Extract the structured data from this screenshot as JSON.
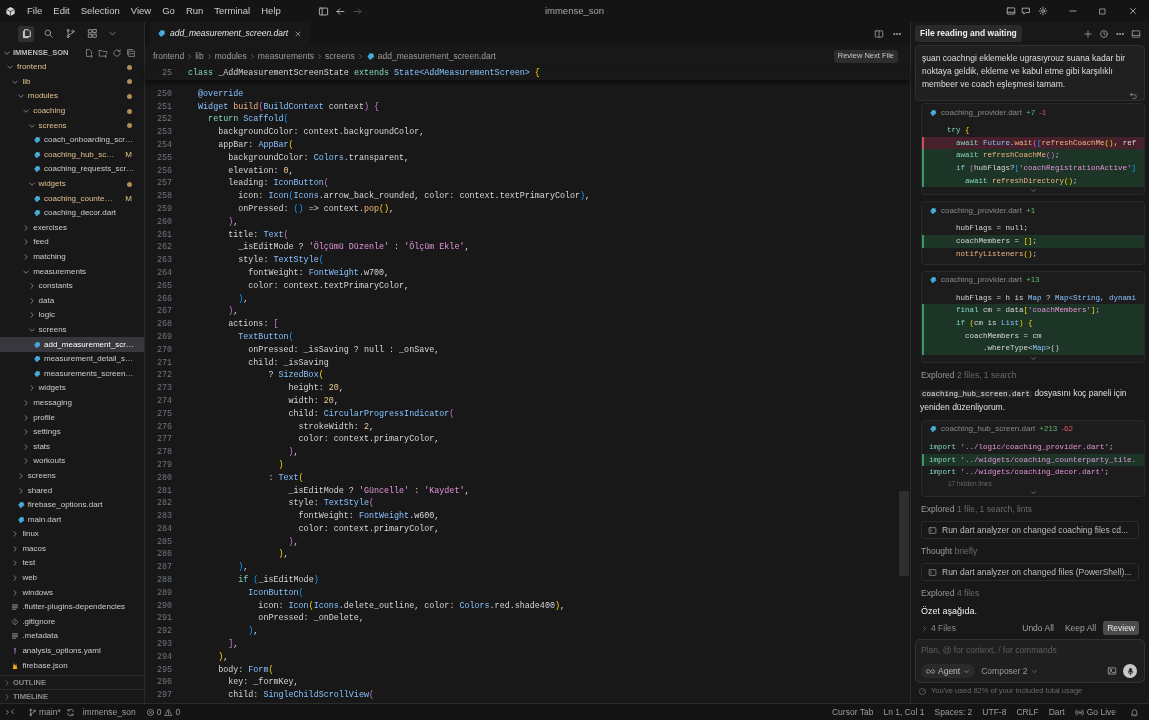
{
  "menu": [
    "File",
    "Edit",
    "Selection",
    "View",
    "Go",
    "Run",
    "Terminal",
    "Help"
  ],
  "window_title": "immense_son",
  "sidebar_tools": [
    {
      "selected": true
    },
    {
      "selected": false
    },
    {
      "selected": false
    },
    {
      "selected": false
    }
  ],
  "explorer": {
    "title": "IMMENSE_SON",
    "expanded": true,
    "tree": [
      {
        "label": "frontend",
        "kind": "folder",
        "expanded": true,
        "modified": true,
        "selected": false,
        "children": [
          {
            "label": "lib",
            "kind": "folder",
            "expanded": true,
            "modified": true,
            "selected": false,
            "children": [
              {
                "label": "modules",
                "kind": "folder",
                "expanded": true,
                "modified": true,
                "selected": false,
                "children": [
                  {
                    "label": "coaching",
                    "kind": "folder",
                    "expanded": true,
                    "modified": true,
                    "selected": false,
                    "children": [
                      {
                        "label": "screens",
                        "kind": "folder",
                        "expanded": true,
                        "modified": true,
                        "selected": false,
                        "children": [
                          {
                            "label": "coach_onboarding_scr…",
                            "kind": "dart",
                            "modified": false,
                            "selected": false
                          },
                          {
                            "label": "coaching_hub_sc…",
                            "kind": "dart",
                            "modified": true,
                            "badge": "M",
                            "selected": false
                          },
                          {
                            "label": "coaching_requests_scr…",
                            "kind": "dart",
                            "modified": false,
                            "selected": false
                          }
                        ]
                      },
                      {
                        "label": "widgets",
                        "kind": "folder",
                        "expanded": true,
                        "modified": true,
                        "selected": false,
                        "children": [
                          {
                            "label": "coaching_counte…",
                            "kind": "dart",
                            "modified": true,
                            "badge": "M",
                            "selected": false
                          },
                          {
                            "label": "coaching_decor.dart",
                            "kind": "dart",
                            "modified": false,
                            "selected": false
                          }
                        ]
                      }
                    ]
                  },
                  {
                    "label": "exercises",
                    "kind": "folder",
                    "expanded": false,
                    "modified": false,
                    "selected": false
                  },
                  {
                    "label": "feed",
                    "kind": "folder",
                    "expanded": false,
                    "modified": false,
                    "selected": false
                  },
                  {
                    "label": "matching",
                    "kind": "folder",
                    "expanded": false,
                    "modified": false,
                    "selected": false
                  },
                  {
                    "label": "measurements",
                    "kind": "folder",
                    "expanded": true,
                    "modified": false,
                    "selected": false,
                    "children": [
                      {
                        "label": "constants",
                        "kind": "folder",
                        "expanded": false,
                        "modified": false,
                        "selected": false
                      },
                      {
                        "label": "data",
                        "kind": "folder",
                        "expanded": false,
                        "modified": false,
                        "selected": false
                      },
                      {
                        "label": "logic",
                        "kind": "folder",
                        "expanded": false,
                        "modified": false,
                        "selected": false
                      },
                      {
                        "label": "screens",
                        "kind": "folder",
                        "expanded": true,
                        "modified": false,
                        "selected": false,
                        "children": [
                          {
                            "label": "add_measurement_scr…",
                            "kind": "dart",
                            "modified": false,
                            "selected": true
                          },
                          {
                            "label": "measurement_detail_s…",
                            "kind": "dart",
                            "modified": false,
                            "selected": false
                          },
                          {
                            "label": "measurements_screen…",
                            "kind": "dart",
                            "modified": false,
                            "selected": false
                          }
                        ]
                      },
                      {
                        "label": "widgets",
                        "kind": "folder",
                        "expanded": false,
                        "modified": false,
                        "selected": false
                      }
                    ]
                  },
                  {
                    "label": "messaging",
                    "kind": "folder",
                    "expanded": false,
                    "modified": false,
                    "selected": false
                  },
                  {
                    "label": "profile",
                    "kind": "folder",
                    "expanded": false,
                    "modified": false,
                    "selected": false
                  },
                  {
                    "label": "settings",
                    "kind": "folder",
                    "expanded": false,
                    "modified": false,
                    "selected": false
                  },
                  {
                    "label": "stats",
                    "kind": "folder",
                    "expanded": false,
                    "modified": false,
                    "selected": false
                  },
                  {
                    "label": "workouts",
                    "kind": "folder",
                    "expanded": false,
                    "modified": false,
                    "selected": false
                  }
                ]
              },
              {
                "label": "screens",
                "kind": "folder",
                "expanded": false,
                "modified": false,
                "selected": false
              },
              {
                "label": "shared",
                "kind": "folder",
                "expanded": false,
                "modified": false,
                "selected": false
              },
              {
                "label": "firebase_options.dart",
                "kind": "dart",
                "modified": false,
                "selected": false
              },
              {
                "label": "main.dart",
                "kind": "dart",
                "modified": false,
                "selected": false
              }
            ]
          },
          {
            "label": "linux",
            "kind": "folder",
            "expanded": false,
            "modified": false,
            "selected": false
          },
          {
            "label": "macos",
            "kind": "folder",
            "expanded": false,
            "modified": false,
            "selected": false
          },
          {
            "label": "test",
            "kind": "folder",
            "expanded": false,
            "modified": false,
            "selected": false
          },
          {
            "label": "web",
            "kind": "folder",
            "expanded": false,
            "modified": false,
            "selected": false
          },
          {
            "label": "windows",
            "kind": "folder",
            "expanded": false,
            "modified": false,
            "selected": false
          },
          {
            "label": ".flutter-plugins-dependencies",
            "kind": "lines",
            "modified": false,
            "selected": false
          },
          {
            "label": ".gitignore",
            "kind": "git",
            "modified": false,
            "selected": false
          },
          {
            "label": ".metadata",
            "kind": "lines",
            "modified": false,
            "selected": false
          },
          {
            "label": "analysis_options.yaml",
            "kind": "yaml",
            "modified": false,
            "selected": false
          },
          {
            "label": "firebase.json",
            "kind": "json",
            "modified": false,
            "selected": false
          }
        ]
      }
    ]
  },
  "panels": [
    {
      "label": "OUTLINE",
      "expanded": false
    },
    {
      "label": "TIMELINE",
      "expanded": false
    }
  ],
  "editor": {
    "tab": {
      "label": "add_measurement_screen.dart",
      "selected": true
    },
    "breadcrumbs": [
      "frontend",
      "lib",
      "modules",
      "measurements",
      "screens",
      "add_measurement_screen.dart"
    ],
    "review_button": "Review Next File",
    "sticky_line": {
      "n": "25",
      "tokens": [
        {
          "text": "class",
          "kind": "k"
        },
        {
          "text": " _AddMeasurementScreenState ",
          "kind": "p"
        },
        {
          "text": "extends",
          "kind": "k"
        },
        {
          "text": " State<AddMeasurementScreen> ",
          "kind": "t"
        },
        {
          "text": "{",
          "kind": "b1"
        }
      ]
    },
    "lines": [
      {
        "n": "250",
        "tokens": [
          {
            "text": "  @override",
            "kind": "t"
          }
        ]
      },
      {
        "n": "251",
        "tokens": [
          {
            "text": "  Widget",
            "kind": "t"
          },
          {
            "text": " build",
            "kind": "f"
          },
          {
            "text": "(",
            "kind": "b2"
          },
          {
            "text": "BuildContext",
            "kind": "t"
          },
          {
            "text": " context",
            "kind": "p"
          },
          {
            "text": ")",
            "kind": "b2"
          },
          {
            "text": " {",
            "kind": "b2"
          }
        ]
      },
      {
        "n": "252",
        "tokens": [
          {
            "text": "    return",
            "kind": "k"
          },
          {
            "text": " Scaffold",
            "kind": "t"
          },
          {
            "text": "(",
            "kind": "b3"
          }
        ]
      },
      {
        "n": "253",
        "tokens": [
          {
            "text": "      backgroundColor: context.backgroundColor,",
            "kind": "p"
          }
        ]
      },
      {
        "n": "254",
        "tokens": [
          {
            "text": "      appBar: ",
            "kind": "p"
          },
          {
            "text": "AppBar",
            "kind": "t"
          },
          {
            "text": "(",
            "kind": "b1"
          }
        ]
      },
      {
        "n": "255",
        "tokens": [
          {
            "text": "        backgroundColor: ",
            "kind": "p"
          },
          {
            "text": "Colors",
            "kind": "t"
          },
          {
            "text": ".transparent,",
            "kind": "p"
          }
        ]
      },
      {
        "n": "256",
        "tokens": [
          {
            "text": "        elevation: ",
            "kind": "p"
          },
          {
            "text": "0",
            "kind": "n"
          },
          {
            "text": ",",
            "kind": "p"
          }
        ]
      },
      {
        "n": "257",
        "tokens": [
          {
            "text": "        leading: ",
            "kind": "p"
          },
          {
            "text": "IconButton",
            "kind": "t"
          },
          {
            "text": "(",
            "kind": "b2"
          }
        ]
      },
      {
        "n": "258",
        "tokens": [
          {
            "text": "          icon: ",
            "kind": "p"
          },
          {
            "text": "Icon",
            "kind": "t"
          },
          {
            "text": "(",
            "kind": "b3"
          },
          {
            "text": "Icons",
            "kind": "t"
          },
          {
            "text": ".arrow_back_rounded, color: context.textPrimaryColor",
            "kind": "p"
          },
          {
            "text": ")",
            "kind": "b3"
          },
          {
            "text": ",",
            "kind": "p"
          }
        ]
      },
      {
        "n": "259",
        "tokens": [
          {
            "text": "          onPressed: ",
            "kind": "p"
          },
          {
            "text": "()",
            "kind": "b3"
          },
          {
            "text": " => context.",
            "kind": "p"
          },
          {
            "text": "pop",
            "kind": "f"
          },
          {
            "text": "()",
            "kind": "b1"
          },
          {
            "text": ",",
            "kind": "p"
          }
        ]
      },
      {
        "n": "260",
        "tokens": [
          {
            "text": "        )",
            "kind": "b2"
          },
          {
            "text": ",",
            "kind": "p"
          }
        ]
      },
      {
        "n": "261",
        "tokens": [
          {
            "text": "        title: ",
            "kind": "p"
          },
          {
            "text": "Text",
            "kind": "t"
          },
          {
            "text": "(",
            "kind": "b2"
          }
        ]
      },
      {
        "n": "262",
        "tokens": [
          {
            "text": "          _isEditMode ? ",
            "kind": "p"
          },
          {
            "text": "'Ölçümü Düzenle'",
            "kind": "s"
          },
          {
            "text": " : ",
            "kind": "p"
          },
          {
            "text": "'Ölçüm Ekle'",
            "kind": "s"
          },
          {
            "text": ",",
            "kind": "p"
          }
        ]
      },
      {
        "n": "263",
        "tokens": [
          {
            "text": "          style: ",
            "kind": "p"
          },
          {
            "text": "TextStyle",
            "kind": "t"
          },
          {
            "text": "(",
            "kind": "b3"
          }
        ]
      },
      {
        "n": "264",
        "tokens": [
          {
            "text": "            fontWeight: ",
            "kind": "p"
          },
          {
            "text": "FontWeight",
            "kind": "t"
          },
          {
            "text": ".w700,",
            "kind": "p"
          }
        ]
      },
      {
        "n": "265",
        "tokens": [
          {
            "text": "            color: context.textPrimaryColor,",
            "kind": "p"
          }
        ]
      },
      {
        "n": "266",
        "tokens": [
          {
            "text": "          )",
            "kind": "b3"
          },
          {
            "text": ",",
            "kind": "p"
          }
        ]
      },
      {
        "n": "267",
        "tokens": [
          {
            "text": "        )",
            "kind": "b2"
          },
          {
            "text": ",",
            "kind": "p"
          }
        ]
      },
      {
        "n": "268",
        "tokens": [
          {
            "text": "        actions: ",
            "kind": "p"
          },
          {
            "text": "[",
            "kind": "b2"
          }
        ]
      },
      {
        "n": "269",
        "tokens": [
          {
            "text": "          TextButton",
            "kind": "t"
          },
          {
            "text": "(",
            "kind": "b3"
          }
        ]
      },
      {
        "n": "270",
        "tokens": [
          {
            "text": "            onPressed: _isSaving ? null : _onSave,",
            "kind": "p"
          }
        ]
      },
      {
        "n": "271",
        "tokens": [
          {
            "text": "            child: _isSaving",
            "kind": "p"
          }
        ]
      },
      {
        "n": "272",
        "tokens": [
          {
            "text": "                ? ",
            "kind": "p"
          },
          {
            "text": "SizedBox",
            "kind": "t"
          },
          {
            "text": "(",
            "kind": "b1"
          }
        ]
      },
      {
        "n": "273",
        "tokens": [
          {
            "text": "                    height: ",
            "kind": "p"
          },
          {
            "text": "20",
            "kind": "n"
          },
          {
            "text": ",",
            "kind": "p"
          }
        ]
      },
      {
        "n": "274",
        "tokens": [
          {
            "text": "                    width: ",
            "kind": "p"
          },
          {
            "text": "20",
            "kind": "n"
          },
          {
            "text": ",",
            "kind": "p"
          }
        ]
      },
      {
        "n": "275",
        "tokens": [
          {
            "text": "                    child: ",
            "kind": "p"
          },
          {
            "text": "CircularProgressIndicator",
            "kind": "t"
          },
          {
            "text": "(",
            "kind": "b2"
          }
        ]
      },
      {
        "n": "276",
        "tokens": [
          {
            "text": "                      strokeWidth: ",
            "kind": "p"
          },
          {
            "text": "2",
            "kind": "n"
          },
          {
            "text": ",",
            "kind": "p"
          }
        ]
      },
      {
        "n": "277",
        "tokens": [
          {
            "text": "                      color: context.primaryColor,",
            "kind": "p"
          }
        ]
      },
      {
        "n": "278",
        "tokens": [
          {
            "text": "                    )",
            "kind": "b2"
          },
          {
            "text": ",",
            "kind": "p"
          }
        ]
      },
      {
        "n": "279",
        "tokens": [
          {
            "text": "                  )",
            "kind": "b1"
          }
        ]
      },
      {
        "n": "280",
        "tokens": [
          {
            "text": "                : ",
            "kind": "p"
          },
          {
            "text": "Text",
            "kind": "t"
          },
          {
            "text": "(",
            "kind": "b1"
          }
        ]
      },
      {
        "n": "281",
        "tokens": [
          {
            "text": "                    _isEditMode ? ",
            "kind": "p"
          },
          {
            "text": "'Güncelle'",
            "kind": "s"
          },
          {
            "text": " : ",
            "kind": "p"
          },
          {
            "text": "'Kaydet'",
            "kind": "s"
          },
          {
            "text": ",",
            "kind": "p"
          }
        ]
      },
      {
        "n": "282",
        "tokens": [
          {
            "text": "                    style: ",
            "kind": "p"
          },
          {
            "text": "TextStyle",
            "kind": "t"
          },
          {
            "text": "(",
            "kind": "b2"
          }
        ]
      },
      {
        "n": "283",
        "tokens": [
          {
            "text": "                      fontWeight: ",
            "kind": "p"
          },
          {
            "text": "FontWeight",
            "kind": "t"
          },
          {
            "text": ".w600,",
            "kind": "p"
          }
        ]
      },
      {
        "n": "284",
        "tokens": [
          {
            "text": "                      color: context.primaryColor,",
            "kind": "p"
          }
        ]
      },
      {
        "n": "285",
        "tokens": [
          {
            "text": "                    )",
            "kind": "b2"
          },
          {
            "text": ",",
            "kind": "p"
          }
        ]
      },
      {
        "n": "286",
        "tokens": [
          {
            "text": "                  )",
            "kind": "b1"
          },
          {
            "text": ",",
            "kind": "p"
          }
        ]
      },
      {
        "n": "287",
        "tokens": [
          {
            "text": "          )",
            "kind": "b3"
          },
          {
            "text": ",",
            "kind": "p"
          }
        ]
      },
      {
        "n": "288",
        "tokens": [
          {
            "text": "          if ",
            "kind": "k"
          },
          {
            "text": "(",
            "kind": "b3"
          },
          {
            "text": "_isEditMode",
            "kind": "p"
          },
          {
            "text": ")",
            "kind": "b3"
          }
        ]
      },
      {
        "n": "289",
        "tokens": [
          {
            "text": "            IconButton",
            "kind": "t"
          },
          {
            "text": "(",
            "kind": "b3"
          }
        ]
      },
      {
        "n": "290",
        "tokens": [
          {
            "text": "              icon: ",
            "kind": "p"
          },
          {
            "text": "Icon",
            "kind": "t"
          },
          {
            "text": "(",
            "kind": "b1"
          },
          {
            "text": "Icons",
            "kind": "t"
          },
          {
            "text": ".delete_outline, color: ",
            "kind": "p"
          },
          {
            "text": "Colors",
            "kind": "t"
          },
          {
            "text": ".red.shade400",
            "kind": "p"
          },
          {
            "text": ")",
            "kind": "b1"
          },
          {
            "text": ",",
            "kind": "p"
          }
        ]
      },
      {
        "n": "291",
        "tokens": [
          {
            "text": "              onPressed: _onDelete,",
            "kind": "p"
          }
        ]
      },
      {
        "n": "292",
        "tokens": [
          {
            "text": "            )",
            "kind": "b3"
          },
          {
            "text": ",",
            "kind": "p"
          }
        ]
      },
      {
        "n": "293",
        "tokens": [
          {
            "text": "        ]",
            "kind": "b2"
          },
          {
            "text": ",",
            "kind": "p"
          }
        ]
      },
      {
        "n": "294",
        "tokens": [
          {
            "text": "      )",
            "kind": "b1"
          },
          {
            "text": ",",
            "kind": "p"
          }
        ]
      },
      {
        "n": "295",
        "tokens": [
          {
            "text": "      body: ",
            "kind": "p"
          },
          {
            "text": "Form",
            "kind": "t"
          },
          {
            "text": "(",
            "kind": "b1"
          }
        ]
      },
      {
        "n": "296",
        "tokens": [
          {
            "text": "        key: _formKey,",
            "kind": "p"
          }
        ]
      },
      {
        "n": "297",
        "tokens": [
          {
            "text": "        child: ",
            "kind": "p"
          },
          {
            "text": "SingleChildScrollView",
            "kind": "t"
          },
          {
            "text": "(",
            "kind": "b2"
          }
        ]
      }
    ]
  },
  "chat": {
    "title": "File reading and waiting",
    "message": "şuan coachngi eklemekle ugrasıyrouz suana kadar bir noktaya geldik, ekleme ve kabul etme gibi karşılıklı membeer ve coach eşleşmesi tamam.",
    "feed": [
      {
        "kind": "diff",
        "file": "coaching_provider.dart",
        "added": "+7",
        "removed": "-1",
        "collapsed": true,
        "lines": [
          {
            "kind": "context",
            "tokens": [
              {
                "text": "    try ",
                "kind": "k"
              },
              {
                "text": "{",
                "kind": "b1"
              }
            ]
          },
          {
            "kind": "removed",
            "tokens": [
              {
                "text": "      await",
                "kind": "k"
              },
              {
                "text": " Future",
                "kind": "t"
              },
              {
                "text": ".",
                "kind": "p"
              },
              {
                "text": "wait",
                "kind": "f"
              },
              {
                "text": "(",
                "kind": "b2"
              },
              {
                "text": "[",
                "kind": "b3"
              },
              {
                "text": "refreshCoachMe",
                "kind": "f"
              },
              {
                "text": "()",
                "kind": "b1"
              },
              {
                "text": ", ref",
                "kind": "p"
              }
            ]
          },
          {
            "kind": "added",
            "tokens": [
              {
                "text": "      await",
                "kind": "k"
              },
              {
                "text": " refreshCoachMe",
                "kind": "f"
              },
              {
                "text": "()",
                "kind": "b2"
              },
              {
                "text": ";",
                "kind": "p"
              }
            ]
          },
          {
            "kind": "added",
            "tokens": [
              {
                "text": "      if ",
                "kind": "k"
              },
              {
                "text": "(",
                "kind": "b2"
              },
              {
                "text": "hubFlags?",
                "kind": "p"
              },
              {
                "text": "[",
                "kind": "b3"
              },
              {
                "text": "'coachRegistrationActive'",
                "kind": "s"
              },
              {
                "text": "]",
                "kind": "b3"
              }
            ]
          },
          {
            "kind": "added",
            "tokens": [
              {
                "text": "        await",
                "kind": "k"
              },
              {
                "text": " refreshDirectory",
                "kind": "f"
              },
              {
                "text": "()",
                "kind": "b1"
              },
              {
                "text": ";",
                "kind": "p"
              }
            ]
          }
        ]
      },
      {
        "kind": "diff",
        "file": "coaching_provider.dart",
        "added": "+1",
        "collapsed": false,
        "lines": [
          {
            "kind": "context",
            "tokens": [
              {
                "text": "      hubFlags = null;",
                "kind": "p"
              }
            ]
          },
          {
            "kind": "added",
            "tokens": [
              {
                "text": "      coachMembers = ",
                "kind": "p"
              },
              {
                "text": "[]",
                "kind": "b1"
              },
              {
                "text": ";",
                "kind": "p"
              }
            ]
          },
          {
            "kind": "context",
            "tokens": [
              {
                "text": "      notifyListeners",
                "kind": "f"
              },
              {
                "text": "()",
                "kind": "b1"
              },
              {
                "text": ";",
                "kind": "p"
              }
            ]
          }
        ]
      },
      {
        "kind": "diff",
        "file": "coaching_provider.dart",
        "added": "+13",
        "collapsed": true,
        "lines": [
          {
            "kind": "context",
            "tokens": [
              {
                "text": "      hubFlags = h is ",
                "kind": "p"
              },
              {
                "text": "Map",
                "kind": "t"
              },
              {
                "text": " ? ",
                "kind": "p"
              },
              {
                "text": "Map<String, dynami",
                "kind": "t"
              }
            ]
          },
          {
            "kind": "added",
            "tokens": [
              {
                "text": "      final",
                "kind": "k"
              },
              {
                "text": " cm = data",
                "kind": "p"
              },
              {
                "text": "[",
                "kind": "b1"
              },
              {
                "text": "'coachMembers'",
                "kind": "s"
              },
              {
                "text": "]",
                "kind": "b1"
              },
              {
                "text": ";",
                "kind": "p"
              }
            ]
          },
          {
            "kind": "added",
            "tokens": [
              {
                "text": "      if ",
                "kind": "k"
              },
              {
                "text": "(",
                "kind": "b1"
              },
              {
                "text": "cm is ",
                "kind": "p"
              },
              {
                "text": "List",
                "kind": "t"
              },
              {
                "text": ")",
                "kind": "b1"
              },
              {
                "text": " {",
                "kind": "b1"
              }
            ]
          },
          {
            "kind": "added",
            "tokens": [
              {
                "text": "        coachMembers = cm",
                "kind": "p"
              }
            ]
          },
          {
            "kind": "added",
            "tokens": [
              {
                "text": "            .whereType<",
                "kind": "p"
              },
              {
                "text": "Map",
                "kind": "t"
              },
              {
                "text": ">()",
                "kind": "p"
              }
            ]
          }
        ]
      },
      {
        "kind": "note",
        "label": "Explored",
        "detail": "2 files, 1 search"
      },
      {
        "kind": "text",
        "code": "coaching_hub_screen.dart",
        "text": " dosyasını koç paneli için yeniden düzenliyorum."
      },
      {
        "kind": "diff",
        "file": "coaching_hub_screen.dart",
        "added": "+213",
        "removed": "-62",
        "collapsed": true,
        "hidden": "17 hidden lines",
        "lines": [
          {
            "kind": "context",
            "tokens": [
              {
                "text": "import",
                "kind": "k"
              },
              {
                "text": " '../logic/coaching_provider.dart'",
                "kind": "s"
              },
              {
                "text": ";",
                "kind": "p"
              }
            ]
          },
          {
            "kind": "added",
            "tokens": [
              {
                "text": "import",
                "kind": "k"
              },
              {
                "text": " '../widgets/coaching_counterparty_tile.",
                "kind": "s"
              }
            ]
          },
          {
            "kind": "context",
            "tokens": [
              {
                "text": "import",
                "kind": "k"
              },
              {
                "text": " '../widgets/coaching_decor.dart'",
                "kind": "s"
              },
              {
                "text": ";",
                "kind": "p"
              }
            ]
          }
        ]
      },
      {
        "kind": "note",
        "label": "Explored",
        "detail": "1 file, 1 search, lints"
      },
      {
        "kind": "tool",
        "label": "Run dart analyzer on changed coaching files cd..."
      },
      {
        "kind": "note",
        "label": "Thought",
        "detail": "briefly"
      },
      {
        "kind": "tool",
        "label": "Run dart analyzer on changed files (PowerShell)..."
      },
      {
        "kind": "note",
        "label": "Explored",
        "detail": "4 files"
      },
      {
        "kind": "summary",
        "text": "Özet aşağıda."
      }
    ],
    "changes": {
      "files": "4 Files",
      "expanded": false,
      "buttons": [
        {
          "label": "Undo All",
          "selected": false
        },
        {
          "label": "Keep All",
          "selected": false
        },
        {
          "label": "Review",
          "selected": true
        }
      ]
    },
    "composer": {
      "placeholder": "Plan, @ for context, / for commands",
      "mode": "Agent",
      "model": "Composer 2"
    },
    "usage": "You've used 82% of your included total usage"
  },
  "status_bar": {
    "branch": "main*",
    "workspace": "immense_son",
    "errors": "0",
    "warnings": "0",
    "items": [
      "Cursor Tab",
      "Ln 1, Col 1",
      "Spaces: 2",
      "UTF-8",
      "CRLF",
      "Dart"
    ],
    "live": "Go Live"
  }
}
